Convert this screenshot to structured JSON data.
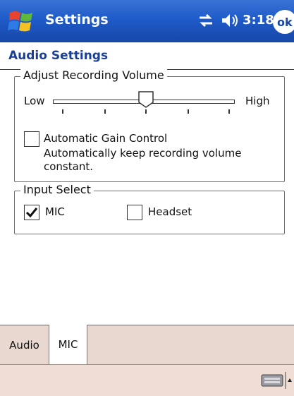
{
  "titlebar": {
    "app_title": "Settings",
    "clock": "3:18",
    "ok_label": "ok",
    "icons": [
      "windows-logo-icon",
      "connectivity-icon",
      "speaker-volume-icon"
    ]
  },
  "page": {
    "title": "Audio Settings"
  },
  "recording_volume": {
    "legend": "Adjust Recording Volume",
    "low_label": "Low",
    "high_label": "High",
    "level_fraction": 0.5,
    "tick_count": 5
  },
  "agc": {
    "label": "Automatic Gain Control",
    "description": "Automatically keep recording volume constant.",
    "checked": false
  },
  "input_select": {
    "legend": "Input Select",
    "options": [
      {
        "label": "MIC",
        "checked": true
      },
      {
        "label": "Headset",
        "checked": false
      }
    ]
  },
  "tabs": [
    {
      "label": "Audio",
      "active": false
    },
    {
      "label": "MIC",
      "active": true
    }
  ],
  "bottombar": {
    "icons": [
      "keyboard-icon",
      "input-panel-arrow-icon"
    ]
  },
  "colors": {
    "titlebar": "#1f5bc9",
    "page_title": "#1b3f97",
    "tab_strip": "#e9d8cf"
  }
}
